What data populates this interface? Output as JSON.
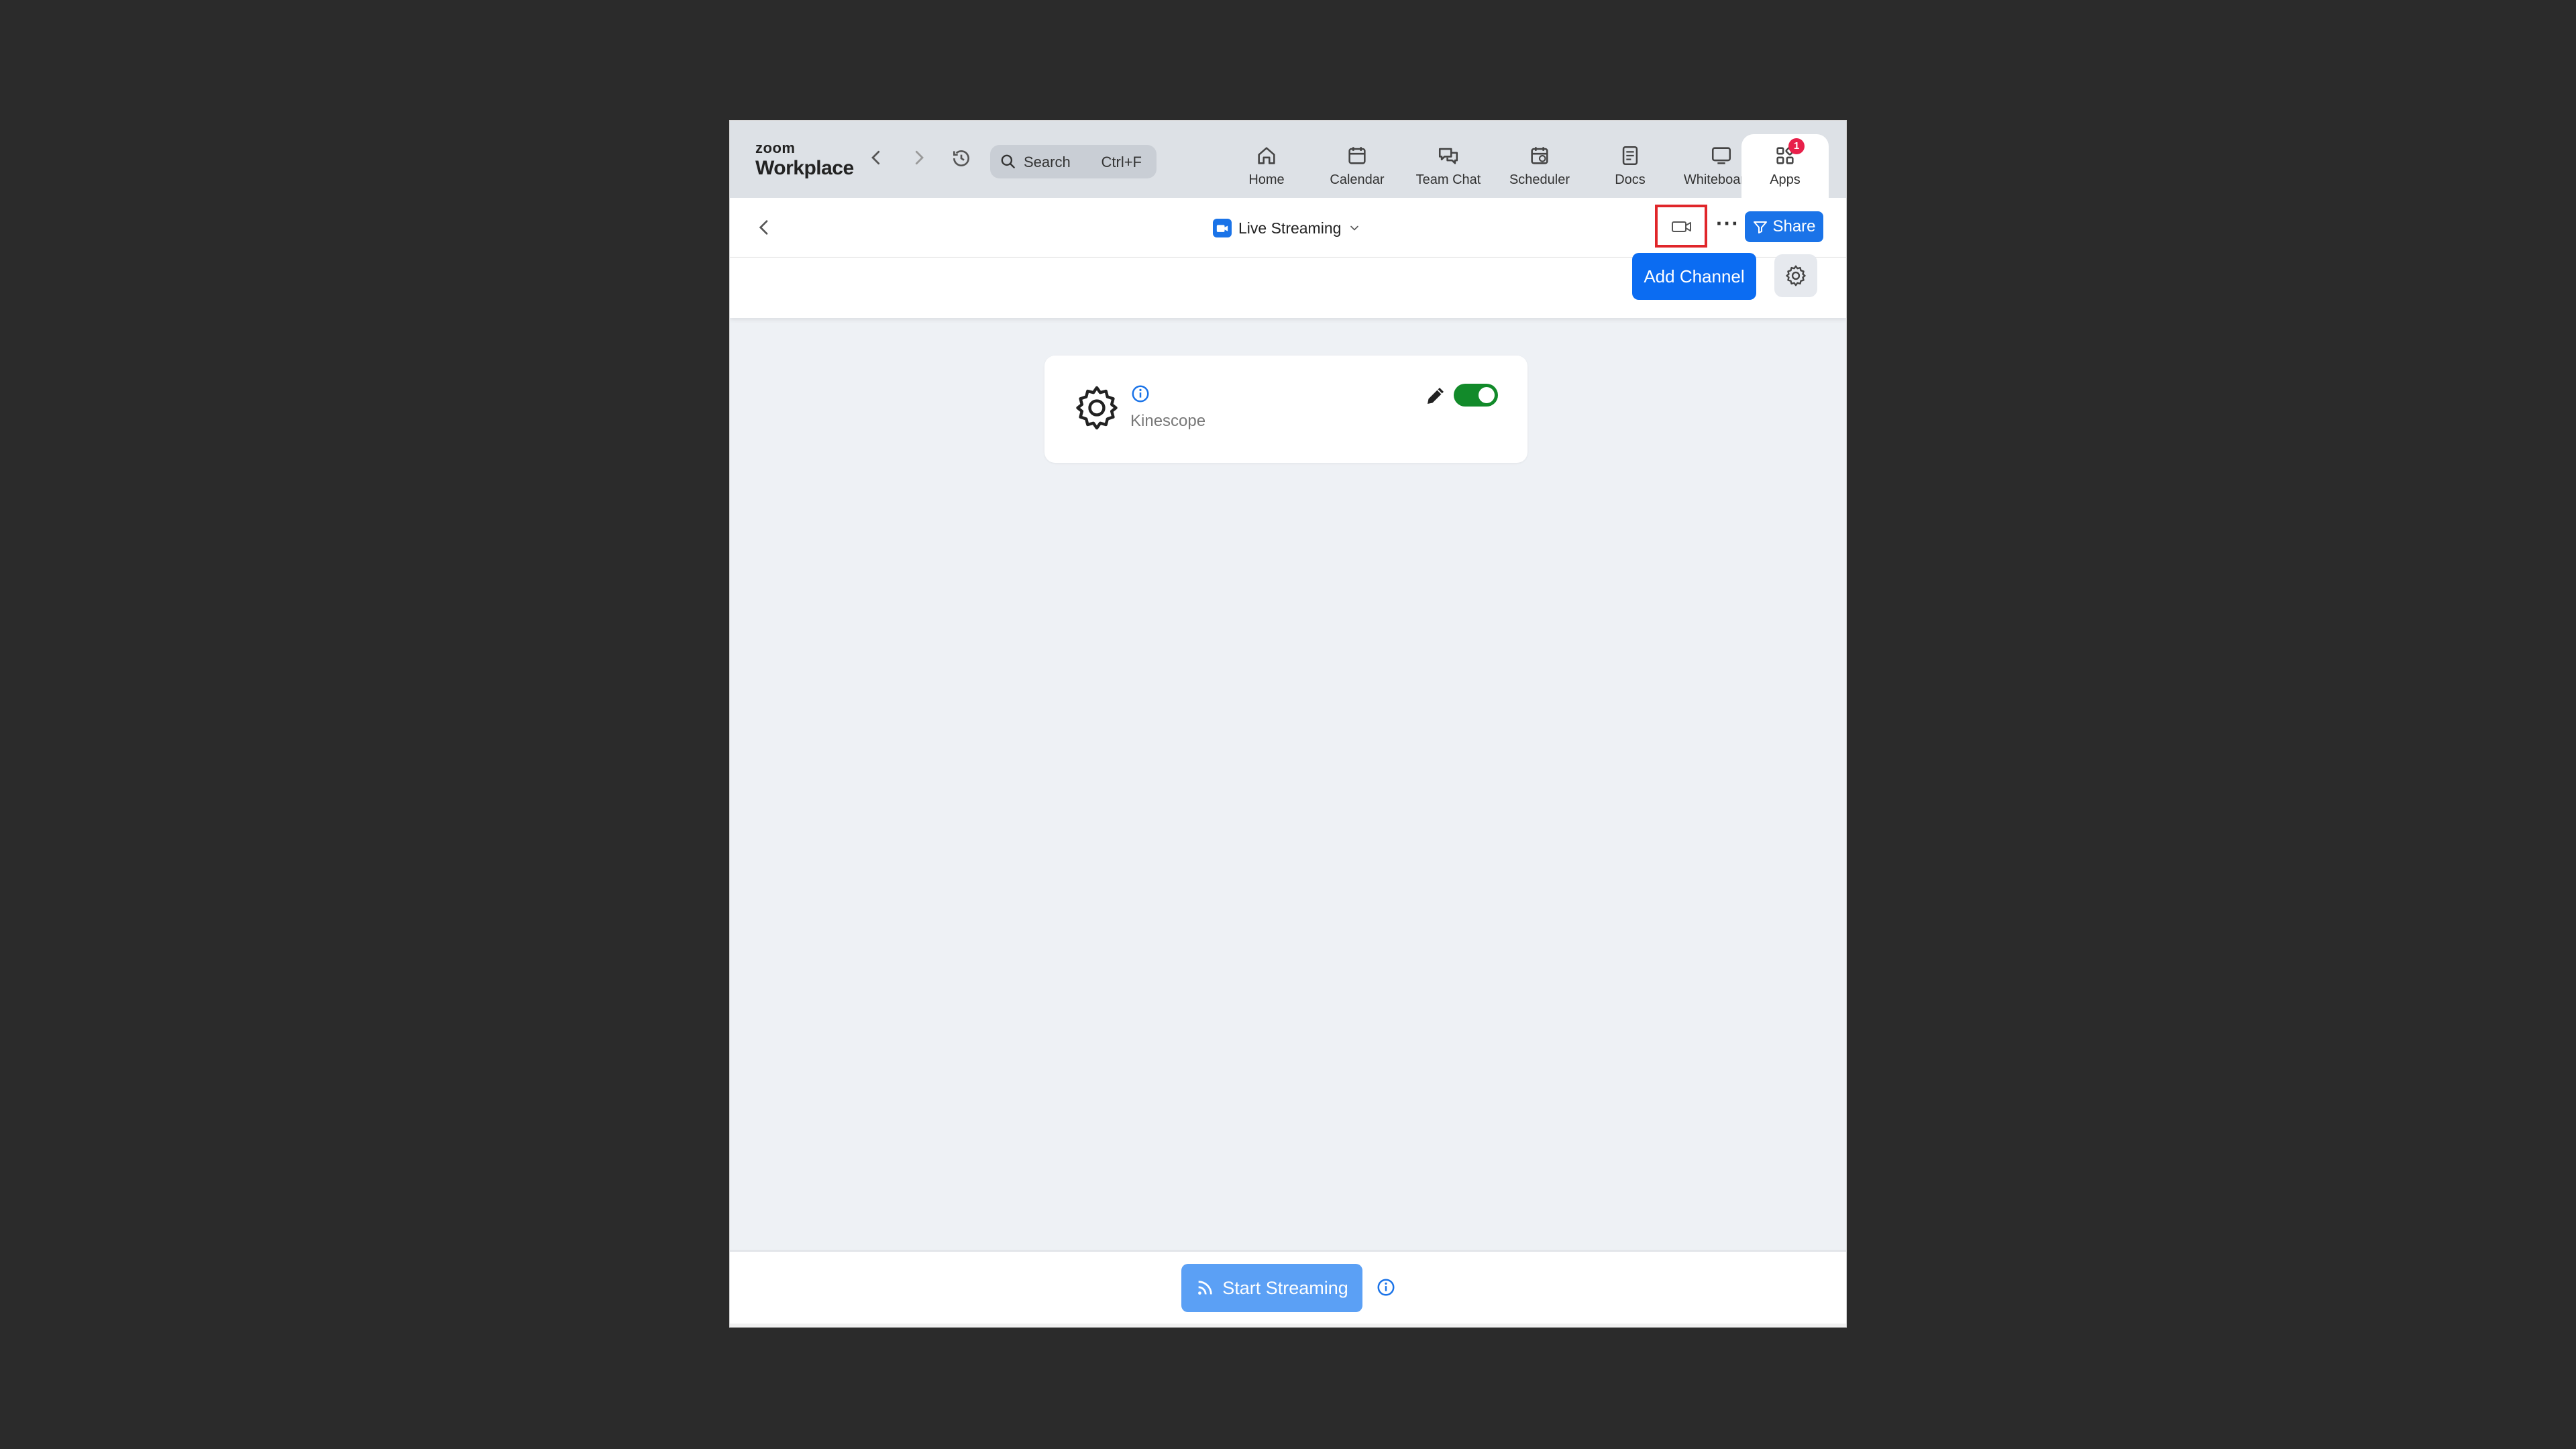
{
  "app": {
    "logo_small": "zoom",
    "logo_big": "Workplace"
  },
  "search": {
    "label": "Search",
    "shortcut": "Ctrl+F"
  },
  "nav": {
    "items": [
      {
        "label": "Home",
        "icon": "home-icon"
      },
      {
        "label": "Calendar",
        "icon": "calendar-icon"
      },
      {
        "label": "Team Chat",
        "icon": "team-chat-icon"
      },
      {
        "label": "Scheduler",
        "icon": "scheduler-icon"
      },
      {
        "label": "Docs",
        "icon": "docs-icon"
      },
      {
        "label": "Whiteboards",
        "icon": "whiteboards-icon"
      },
      {
        "label": "Apps",
        "icon": "apps-icon",
        "badge": "1",
        "active": true
      }
    ]
  },
  "header": {
    "app_title": "Live Streaming",
    "share_label": "Share"
  },
  "toolbar": {
    "add_channel_label": "Add Channel"
  },
  "channels": [
    {
      "name": "Kinescope",
      "enabled": true
    }
  ],
  "footer": {
    "start_label": "Start Streaming"
  },
  "colors": {
    "accent": "#0b6cf2",
    "toggle_on": "#128a2a",
    "highlight_box": "#e0262a",
    "badge": "#e8204a"
  }
}
